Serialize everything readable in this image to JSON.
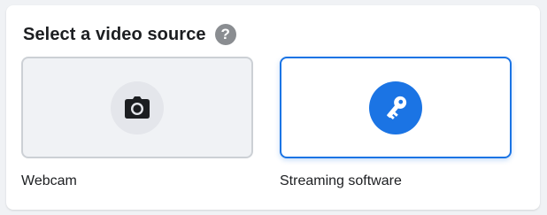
{
  "section": {
    "title": "Select a video source",
    "help_icon_glyph": "?"
  },
  "options": [
    {
      "label": "Webcam",
      "icon": "camera-icon",
      "selected": false
    },
    {
      "label": "Streaming software",
      "icon": "key-icon",
      "selected": true
    }
  ],
  "colors": {
    "accent": "#1b74e4",
    "card_background": "#ffffff",
    "page_background": "#f0f2f5",
    "unselected_border": "#ccd0d5",
    "help_icon": "#8a8d91"
  }
}
